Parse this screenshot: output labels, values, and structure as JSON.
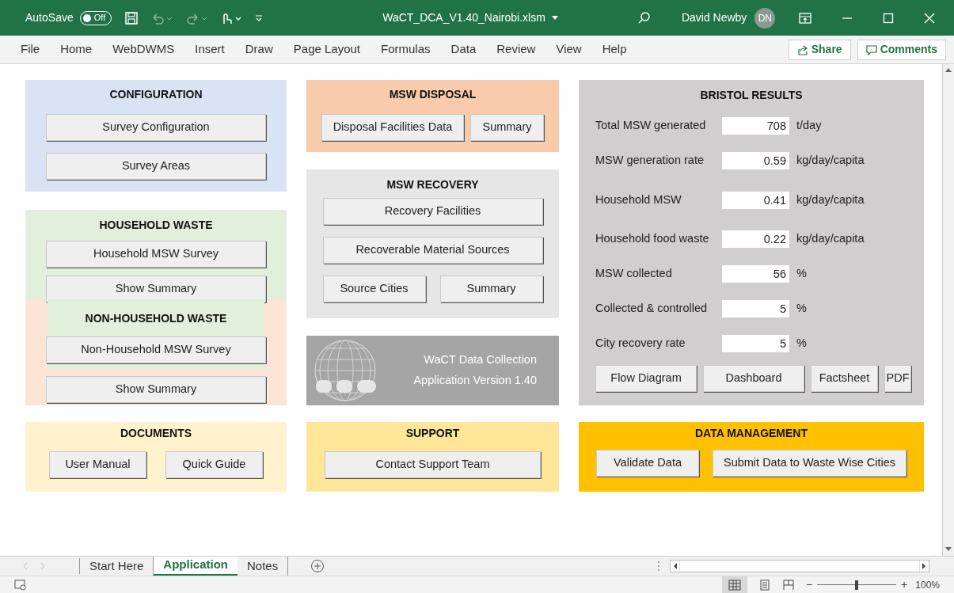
{
  "title_bar": {
    "autosave": {
      "label": "AutoSave",
      "on": false,
      "state_text": "Off"
    },
    "filename": "WaCT_DCA_V1.40_Nairobi.xlsm",
    "user": "David Newby",
    "initials": "DN"
  },
  "menu": {
    "items": [
      "File",
      "Home",
      "WebDWMS",
      "Insert",
      "Draw",
      "Page Layout",
      "Formulas",
      "Data",
      "Review",
      "View",
      "Help"
    ],
    "share": "Share",
    "comments": "Comments"
  },
  "configuration": {
    "title": "CONFIGURATION",
    "buttons": [
      "Survey Configuration",
      "Survey Areas"
    ]
  },
  "household_waste": {
    "title": "HOUSEHOLD WASTE",
    "buttons": [
      "Household MSW Survey",
      "Show Summary"
    ]
  },
  "non_household_waste": {
    "title": "NON-HOUSEHOLD WASTE",
    "buttons": [
      "Non-Household MSW Survey",
      "Show Summary"
    ]
  },
  "msw_disposal": {
    "title": "MSW DISPOSAL",
    "buttons": [
      "Disposal Facilities Data",
      "Summary"
    ]
  },
  "msw_recovery": {
    "title": "MSW RECOVERY",
    "buttons": [
      "Recovery Facilities",
      "Recoverable Material Sources",
      "Source Cities",
      "Summary"
    ]
  },
  "about": {
    "lines": [
      "WaCT Data Collection",
      "Application Version 1.40"
    ]
  },
  "bristol_results": {
    "title": "BRISTOL RESULTS",
    "rows": [
      {
        "label": "Total MSW generated",
        "value": "708",
        "unit": "t/day"
      },
      {
        "label": "MSW generation rate",
        "value": "0.59",
        "unit": "kg/day/capita"
      },
      {
        "label": "Household MSW",
        "value": "0.41",
        "unit": "kg/day/capita"
      },
      {
        "label": "Household food waste",
        "value": "0.22",
        "unit": "kg/day/capita"
      },
      {
        "label": "MSW collected",
        "value": "56",
        "unit": "%"
      },
      {
        "label": "Collected & controlled",
        "value": "5",
        "unit": "%"
      },
      {
        "label": "City recovery rate",
        "value": "5",
        "unit": "%"
      }
    ],
    "buttons": [
      "Flow Diagram",
      "Dashboard",
      "Factsheet",
      "PDF"
    ]
  },
  "documents": {
    "title": "DOCUMENTS",
    "buttons": [
      "User Manual",
      "Quick Guide"
    ]
  },
  "support": {
    "title": "SUPPORT",
    "buttons": [
      "Contact Support Team"
    ]
  },
  "data_management": {
    "title": "DATA MANAGEMENT",
    "buttons": [
      "Validate Data",
      "Submit Data to Waste Wise Cities"
    ]
  },
  "sheet_tabs": [
    {
      "label": "Start Here",
      "selected": false
    },
    {
      "label": "Application",
      "selected": true
    },
    {
      "label": "Notes",
      "selected": false
    }
  ],
  "status_bar": {
    "zoom_out": "−",
    "zoom_slider": {
      "level": 0.5
    },
    "zoom_in": "+",
    "zoom": "100%"
  }
}
